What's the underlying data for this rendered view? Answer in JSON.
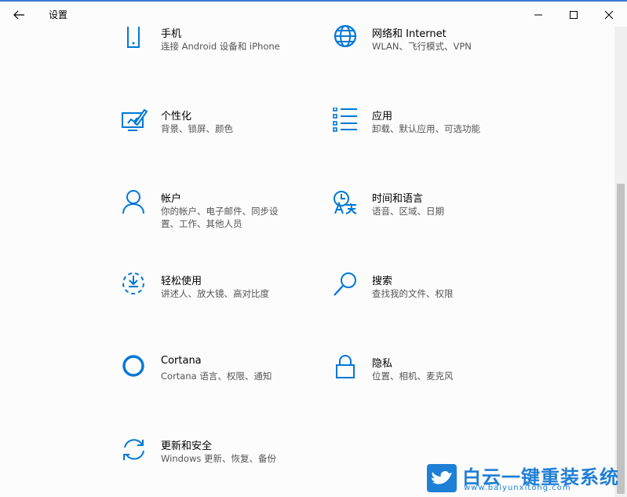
{
  "window": {
    "title": "设置",
    "accent_color": "#0078d7",
    "controls": [
      "minimize",
      "maximize",
      "close"
    ]
  },
  "items": [
    {
      "title": "手机",
      "desc": "连接 Android 设备和 iPhone",
      "icon": "phone-icon"
    },
    {
      "title": "网络和 Internet",
      "desc": "WLAN、飞行模式、VPN",
      "icon": "globe-icon"
    },
    {
      "title": "个性化",
      "desc": "背景、锁屏、颜色",
      "icon": "personalization-icon"
    },
    {
      "title": "应用",
      "desc": "卸载、默认应用、可选功能",
      "icon": "apps-list-icon"
    },
    {
      "title": "帐户",
      "desc": "你的帐户、电子邮件、同步设置、工作、其他人员",
      "icon": "person-icon"
    },
    {
      "title": "时间和语言",
      "desc": "语音、区域、日期",
      "icon": "time-language-icon"
    },
    {
      "title": "轻松使用",
      "desc": "讲述人、放大镜、高对比度",
      "icon": "ease-of-access-icon"
    },
    {
      "title": "搜索",
      "desc": "查找我的文件、权限",
      "icon": "search-icon"
    },
    {
      "title": "Cortana",
      "desc": "Cortana 语言、权限、通知",
      "icon": "cortana-icon"
    },
    {
      "title": "隐私",
      "desc": "位置、相机、麦克风",
      "icon": "lock-icon"
    },
    {
      "title": "更新和安全",
      "desc": "Windows 更新、恢复、备份",
      "icon": "update-icon"
    }
  ],
  "watermark": {
    "text": "白云一键重装系统",
    "url": "www.baiyunxitong.com",
    "color": "#1e7fd6"
  }
}
